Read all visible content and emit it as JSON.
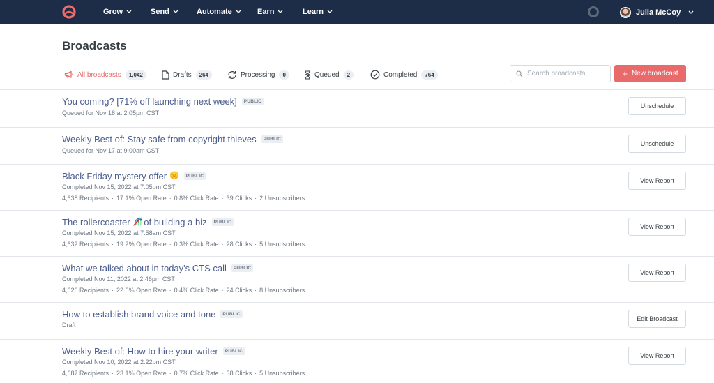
{
  "nav": {
    "items": [
      {
        "label": "Grow"
      },
      {
        "label": "Send"
      },
      {
        "label": "Automate"
      },
      {
        "label": "Earn"
      },
      {
        "label": "Learn"
      }
    ],
    "user_name": "Julia McCoy"
  },
  "page": {
    "title": "Broadcasts"
  },
  "tabs": [
    {
      "label": "All broadcasts",
      "count": "1,042",
      "icon": "megaphone-icon"
    },
    {
      "label": "Drafts",
      "count": "264",
      "icon": "document-icon"
    },
    {
      "label": "Processing",
      "count": "0",
      "icon": "refresh-icon"
    },
    {
      "label": "Queued",
      "count": "2",
      "icon": "hourglass-icon"
    },
    {
      "label": "Completed",
      "count": "764",
      "icon": "check-circle-icon"
    }
  ],
  "search": {
    "placeholder": "Search broadcasts"
  },
  "new_button": {
    "label": "New broadcast"
  },
  "colors": {
    "accent": "#e86a6a",
    "nav_bg": "#1d2c47",
    "link": "#4a5d8f"
  },
  "broadcasts": [
    {
      "title": "You coming? [71% off launching next week]",
      "badge": "PUBLIC",
      "status": "Queued for Nov 18 at 2:05pm CST",
      "action": "Unschedule"
    },
    {
      "title": "Weekly Best of: Stay safe from copyright thieves",
      "badge": "PUBLIC",
      "status": "Queued for Nov 17 at 9:00am CST",
      "action": "Unschedule"
    },
    {
      "title": "Black Friday mystery offer",
      "emoji": "🤫",
      "badge": "PUBLIC",
      "status": "Completed Nov 15, 2022 at 7:05pm CST",
      "recipients": "4,638 Recipients",
      "open_rate": "17.1% Open Rate",
      "click_rate": "0.8% Click Rate",
      "clicks": "39 Clicks",
      "unsubscribers": "2 Unsubscribers",
      "action": "View Report"
    },
    {
      "title": "The rollercoaster",
      "emoji": "🎢",
      "title_tail": "of building a biz",
      "badge": "PUBLIC",
      "status": "Completed Nov 15, 2022 at 7:58am CST",
      "recipients": "4,632 Recipients",
      "open_rate": "19.2% Open Rate",
      "click_rate": "0.3% Click Rate",
      "clicks": "28 Clicks",
      "unsubscribers": "5 Unsubscribers",
      "action": "View Report"
    },
    {
      "title": "What we talked about in today's CTS call",
      "badge": "PUBLIC",
      "status": "Completed Nov 11, 2022 at 2:46pm CST",
      "recipients": "4,626 Recipients",
      "open_rate": "22.6% Open Rate",
      "click_rate": "0.4% Click Rate",
      "clicks": "24 Clicks",
      "unsubscribers": "8 Unsubscribers",
      "action": "View Report"
    },
    {
      "title": "How to establish brand voice and tone",
      "badge": "PUBLIC",
      "status": "Draft",
      "action": "Edit Broadcast"
    },
    {
      "title": "Weekly Best of: How to hire your writer",
      "badge": "PUBLIC",
      "status": "Completed Nov 10, 2022 at 2:22pm CST",
      "recipients": "4,687 Recipients",
      "open_rate": "23.1% Open Rate",
      "click_rate": "0.7% Click Rate",
      "clicks": "38 Clicks",
      "unsubscribers": "5 Unsubscribers",
      "action": "View Report"
    }
  ]
}
